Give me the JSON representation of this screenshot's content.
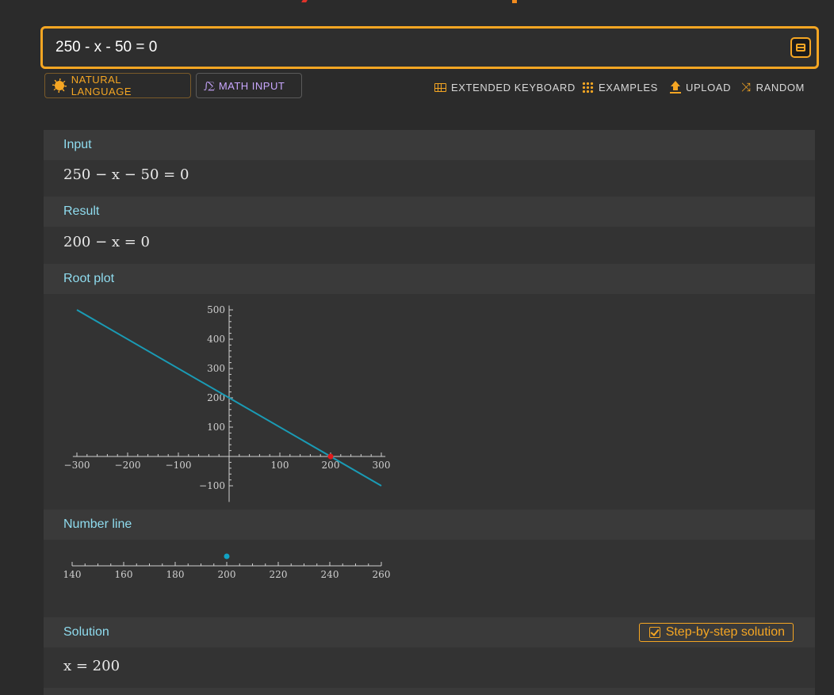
{
  "search": {
    "query": "250 - x - 50 = 0",
    "compute_label": "="
  },
  "modes": {
    "natural_language": "NATURAL LANGUAGE",
    "math_input": "MATH INPUT"
  },
  "toolbar": {
    "extended_keyboard": "EXTENDED KEYBOARD",
    "examples": "EXAMPLES",
    "upload": "UPLOAD",
    "random": "RANDOM"
  },
  "pods": {
    "input": {
      "title": "Input",
      "math": "250 − x − 50 = 0"
    },
    "result": {
      "title": "Result",
      "math": "200 − x = 0"
    },
    "root_plot": {
      "title": "Root plot"
    },
    "number_line": {
      "title": "Number line"
    },
    "solution": {
      "title": "Solution",
      "math": "x = 200",
      "step_button": "Step-by-step solution"
    }
  },
  "chart_data": [
    {
      "type": "line",
      "title": "",
      "xlabel": "",
      "ylabel": "",
      "xlim": [
        -300,
        300
      ],
      "ylim": [
        -100,
        500
      ],
      "x_ticks": [
        "−300",
        "−200",
        "−100",
        "100",
        "200",
        "300"
      ],
      "y_ticks": [
        "500",
        "400",
        "300",
        "200",
        "100",
        "−100"
      ],
      "series": [
        {
          "x": [
            -300,
            300
          ],
          "y": [
            500,
            -100
          ],
          "color": "#1a9bb5"
        }
      ],
      "root": {
        "x": 200,
        "y": 0,
        "color": "#e0191b"
      }
    },
    {
      "type": "scatter",
      "xlim": [
        140,
        260
      ],
      "x_ticks": [
        "140",
        "160",
        "180",
        "200",
        "220",
        "240",
        "260"
      ],
      "points": [
        200
      ],
      "color": "#11a3c4"
    }
  ]
}
